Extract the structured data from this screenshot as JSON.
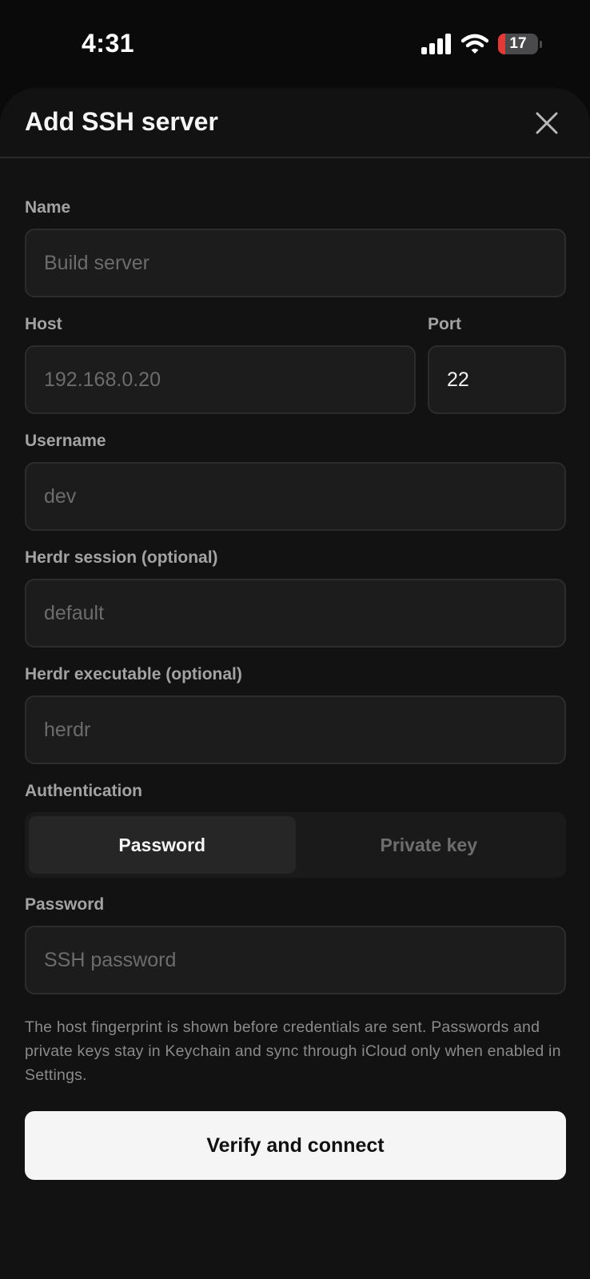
{
  "status_bar": {
    "time": "4:31",
    "battery_level": "17",
    "battery_fraction": 0.17,
    "battery_color": "#e53935",
    "icons": [
      "cellular-signal-icon",
      "wifi-icon",
      "battery-icon"
    ]
  },
  "sheet": {
    "title": "Add SSH server",
    "close_icon": "close-icon"
  },
  "fields": {
    "name": {
      "label": "Name",
      "value": "",
      "placeholder": "Build server"
    },
    "host": {
      "label": "Host",
      "value": "",
      "placeholder": "192.168.0.20"
    },
    "port": {
      "label": "Port",
      "value": "22",
      "placeholder": ""
    },
    "username": {
      "label": "Username",
      "value": "",
      "placeholder": "dev"
    },
    "session": {
      "label": "Herdr session (optional)",
      "value": "",
      "placeholder": "default"
    },
    "executable": {
      "label": "Herdr executable (optional)",
      "value": "",
      "placeholder": "herdr"
    },
    "password": {
      "label": "Password",
      "value": "",
      "placeholder": "SSH password"
    }
  },
  "authentication": {
    "label": "Authentication",
    "options": [
      "Password",
      "Private key"
    ],
    "selected": "Password"
  },
  "info_text": "The host fingerprint is shown before credentials are sent. Passwords and private keys stay in Keychain and sync through iCloud only when enabled in Settings.",
  "primary_button": "Verify and connect",
  "colors": {
    "background": "#0a0a0a",
    "sheet": "#121212",
    "field": "#1c1c1c",
    "button": "#f5f5f5"
  }
}
